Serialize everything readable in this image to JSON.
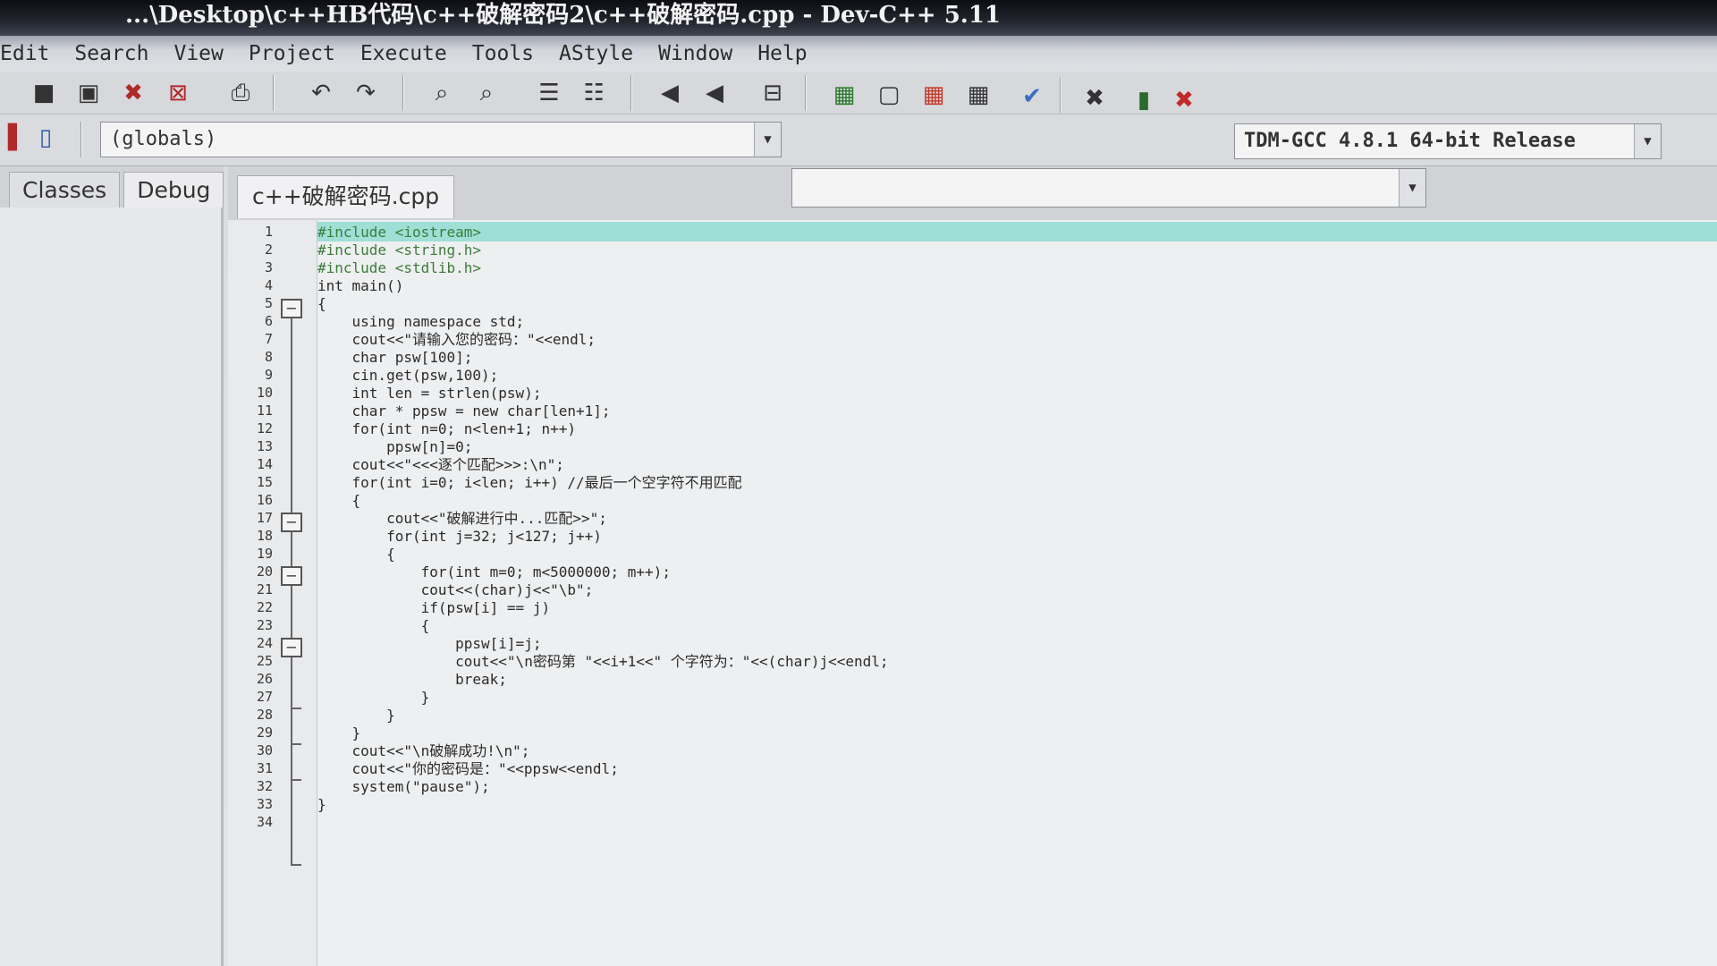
{
  "window": {
    "title": "...\\Desktop\\c++HB代码\\c++破解密码2\\c++破解密码.cpp - Dev-C++ 5.11"
  },
  "menu": [
    "Edit",
    "Search",
    "View",
    "Project",
    "Execute",
    "Tools",
    "AStyle",
    "Window",
    "Help"
  ],
  "toolbar": {
    "globals_combo": "(globals)",
    "compiler_combo": "TDM-GCC 4.8.1 64-bit Release"
  },
  "left_panel": {
    "tabs": [
      "Classes",
      "Debug"
    ]
  },
  "editor": {
    "file_tab": "c++破解密码.cpp",
    "line_numbers": [
      "1",
      "2",
      "3",
      "4",
      "5",
      "6",
      "7",
      "8",
      "9",
      "10",
      "11",
      "12",
      "13",
      "14",
      "15",
      "16",
      "17",
      "18",
      "19",
      "20",
      "21",
      "22",
      "23",
      "24",
      "25",
      "26",
      "27",
      "28",
      "29",
      "30",
      "31",
      "32",
      "33",
      "34"
    ],
    "lines": [
      "#include <iostream>",
      "#include <string.h>",
      "#include <stdlib.h>",
      "int main()",
      "{",
      "    using namespace std;",
      "    cout<<\"请输入您的密码：\"<<endl;",
      "    char psw[100];",
      "    cin.get(psw,100);",
      "    int len = strlen(psw);",
      "    char * ppsw = new char[len+1];",
      "    for(int n=0; n<len+1; n++)",
      "        ppsw[n]=0;",
      "    cout<<\"<<<逐个匹配>>>:\\n\";",
      "    for(int i=0; i<len; i++) //最后一个空字符不用匹配",
      "    {",
      "        cout<<\"破解进行中...匹配>>\";",
      "        for(int j=32; j<127; j++)",
      "        {",
      "            for(int m=0; m<5000000; m++);",
      "            cout<<(char)j<<\"\\b\";",
      "            if(psw[i] == j)",
      "            {",
      "                ppsw[i]=j;",
      "                cout<<\"\\n密码第 \"<<i+1<<\" 个字符为：\"<<(char)j<<endl;",
      "                break;",
      "            }",
      "        }",
      "    }",
      "    cout<<\"\\n破解成功!\\n\";",
      "    cout<<\"你的密码是：\"<<ppsw<<endl;",
      "    system(\"pause\");",
      "}",
      ""
    ]
  }
}
